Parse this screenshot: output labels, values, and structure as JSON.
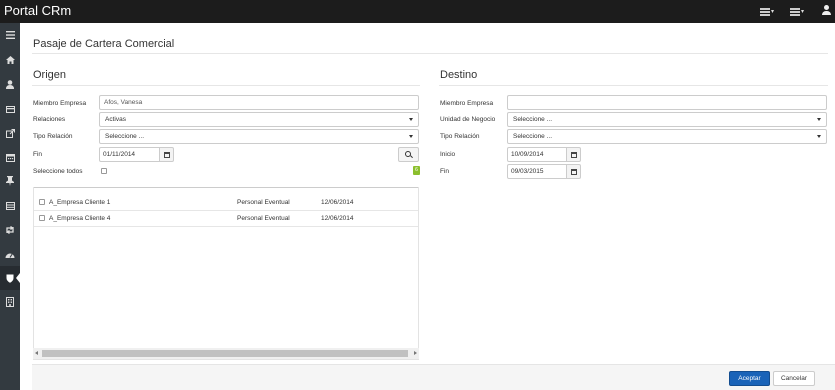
{
  "app": {
    "title": "Portal CRm",
    "sidebar_icons": [
      "menu-icon",
      "home-icon",
      "user-icon",
      "card-icon",
      "external-link-icon",
      "calendar-icon",
      "pin-icon",
      "list-icon",
      "retweet-icon",
      "dashboard-icon",
      "shield-icon",
      "building-icon"
    ],
    "active_sidebar": "shield-icon"
  },
  "page": {
    "title": "Pasaje de Cartera Comercial"
  },
  "origen": {
    "title": "Origen",
    "miembro_label": "Miembro Empresa",
    "miembro_value": "Afos, Vanesa",
    "relaciones_label": "Relaciones",
    "relaciones_value": "Activas",
    "tipo_label": "Tipo Relación",
    "tipo_value": "Seleccione ...",
    "fin_label": "Fin",
    "fin_value": "01/11/2014",
    "seleccione_todos_label": "Seleccione todos",
    "badge_count": "6"
  },
  "destino": {
    "title": "Destino",
    "miembro_label": "Miembro Empresa",
    "miembro_value": "",
    "unidad_label": "Unidad de Negocio",
    "unidad_value": "Seleccione ...",
    "tipo_label": "Tipo Relación",
    "tipo_value": "Seleccione ...",
    "inicio_label": "Inicio",
    "inicio_value": "10/09/2014",
    "fin_label": "Fin",
    "fin_value": "09/03/2015"
  },
  "results": {
    "rows": [
      {
        "name": "A_Empresa Cliente 1",
        "type": "Personal Eventual",
        "date": "12/06/2014"
      },
      {
        "name": "A_Empresa Cliente 4",
        "type": "Personal Eventual",
        "date": "12/06/2014"
      }
    ]
  },
  "footer": {
    "accept_label": "Aceptar",
    "cancel_label": "Cancelar"
  },
  "colors": {
    "navbar": "#1c1c1c",
    "sidebar": "#333a40",
    "primary": "#1a63b8",
    "badge": "#8bbf2d"
  }
}
